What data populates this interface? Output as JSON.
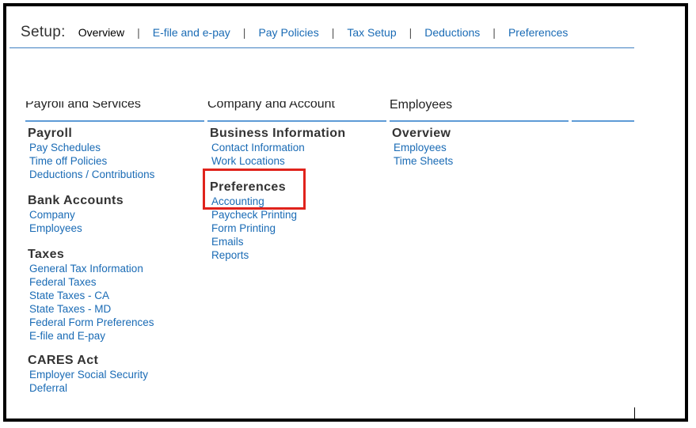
{
  "nav": {
    "setup_label": "Setup:",
    "tabs": [
      {
        "label": "Overview",
        "active": true
      },
      {
        "label": "E-file and e-pay",
        "active": false
      },
      {
        "label": "Pay Policies",
        "active": false
      },
      {
        "label": "Tax Setup",
        "active": false
      },
      {
        "label": "Deductions",
        "active": false
      },
      {
        "label": "Preferences",
        "active": false
      }
    ],
    "separator": "|"
  },
  "columns": [
    {
      "heading": "Payroll and Services"
    },
    {
      "heading": "Company and Account"
    },
    {
      "heading": "Employees"
    }
  ],
  "payroll_col": {
    "payroll": {
      "title": "Payroll",
      "links": [
        "Pay Schedules",
        "Time off Policies",
        "Deductions / Contributions"
      ]
    },
    "bank": {
      "title": "Bank Accounts",
      "links": [
        "Company",
        "Employees"
      ]
    },
    "taxes": {
      "title": "Taxes",
      "links": [
        "General Tax Information",
        "Federal Taxes",
        "State Taxes - CA",
        "State Taxes - MD",
        "Federal Form Preferences",
        "E-file and E-pay"
      ]
    },
    "cares": {
      "title": "CARES Act",
      "links": [
        "Employer Social Security",
        "Deferral"
      ]
    }
  },
  "company_col": {
    "business": {
      "title": "Business Information",
      "links": [
        "Contact Information",
        "Work Locations"
      ]
    },
    "preferences": {
      "title": "Preferences",
      "links": [
        "Accounting",
        "Paycheck Printing",
        "Form Printing",
        "Emails",
        "Reports"
      ]
    }
  },
  "employees_col": {
    "overview": {
      "title": "Overview",
      "links": [
        "Employees",
        "Time Sheets"
      ]
    }
  },
  "colors": {
    "link": "#1a6bb5",
    "highlight": "#e0231c",
    "divider": "#5e9bd6"
  }
}
